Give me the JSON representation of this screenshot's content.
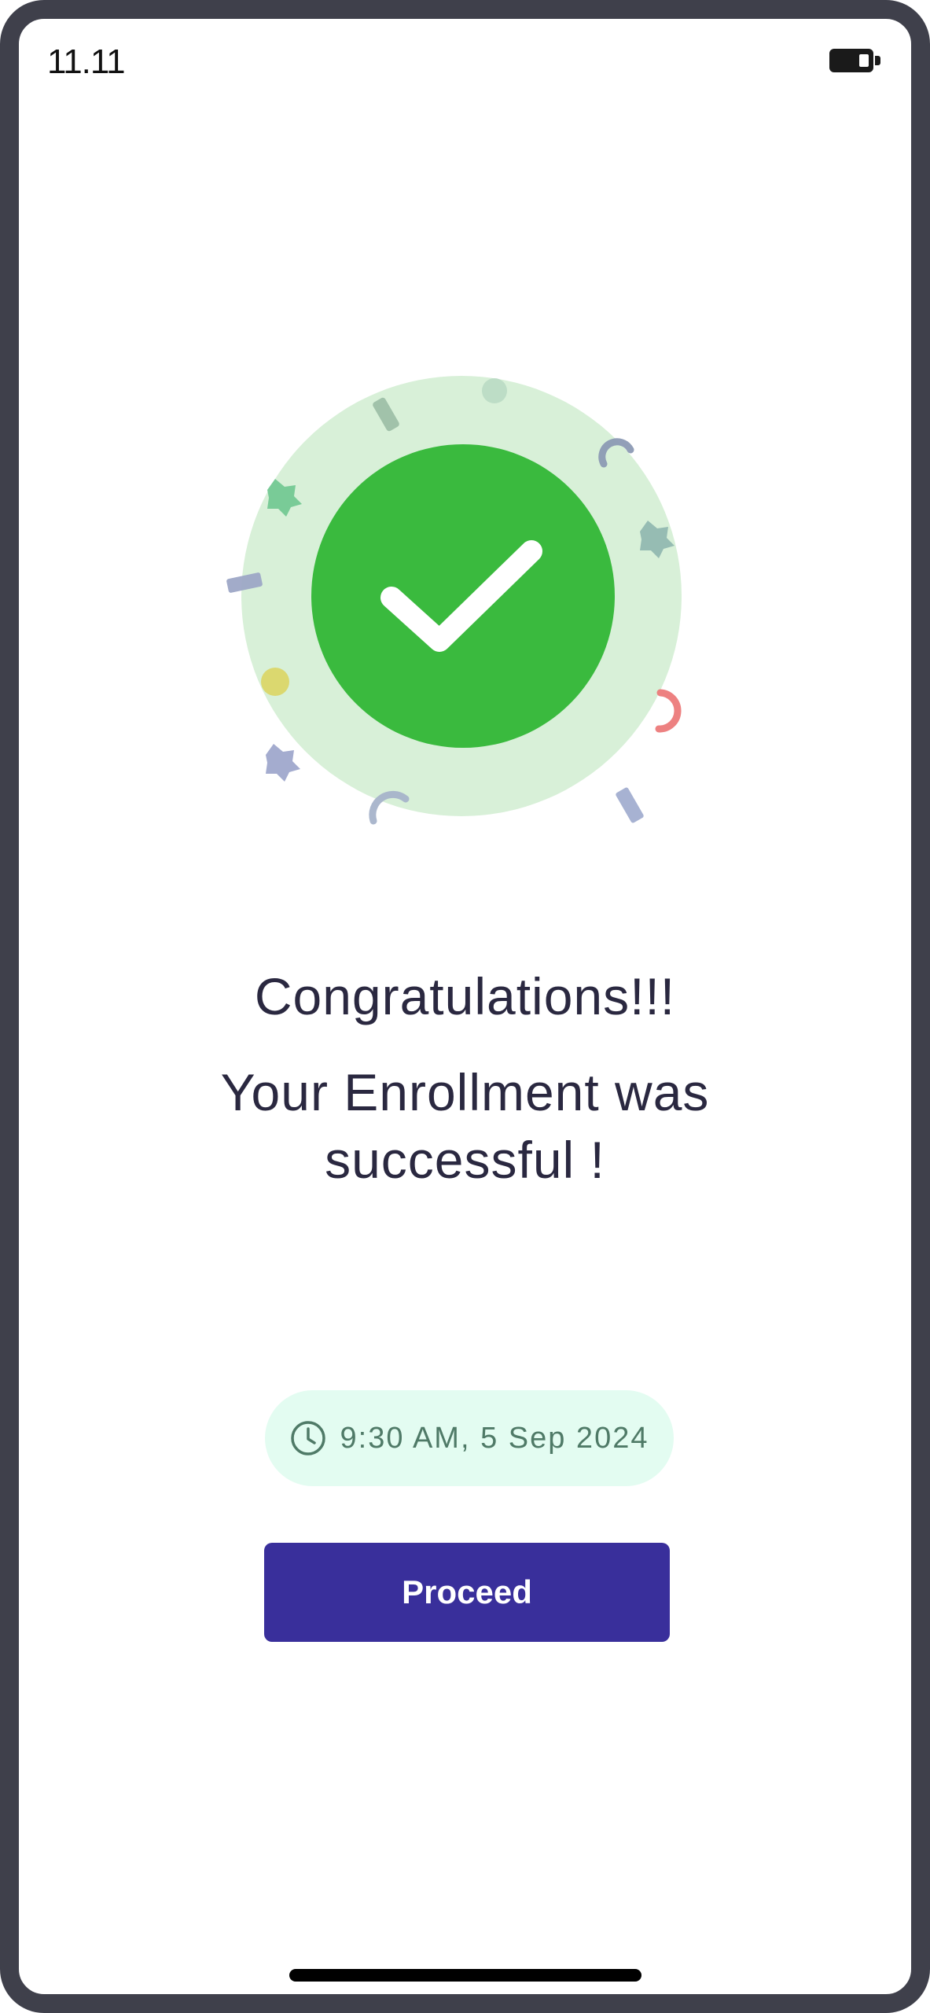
{
  "status_bar": {
    "time": "11.11",
    "battery_icon": "battery-icon"
  },
  "illustration": {
    "icon": "checkmark-icon",
    "colors": {
      "outer_ring": "#d8f0d8",
      "inner_circle": "#3aba3e",
      "check": "#ffffff"
    }
  },
  "content": {
    "title": "Congratulations!!!",
    "message": "Your Enrollment was successful !"
  },
  "timestamp": {
    "icon": "clock-icon",
    "text": "9:30 AM, 5 Sep 2024"
  },
  "actions": {
    "proceed_label": "Proceed"
  },
  "colors": {
    "primary": "#392f9b",
    "pill_background": "#e3fcf1",
    "pill_text": "#4f7a67",
    "heading_text": "#2a2840"
  }
}
